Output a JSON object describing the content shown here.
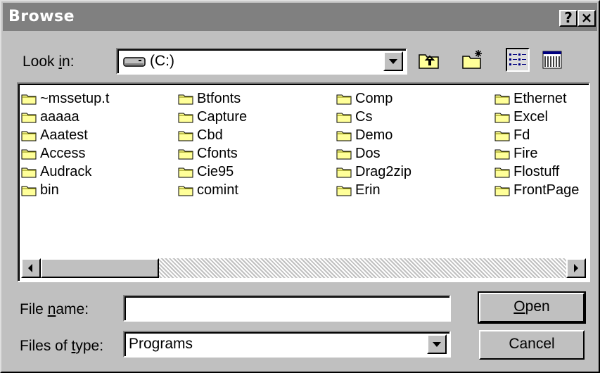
{
  "dialog": {
    "title": "Browse",
    "help_label": "?",
    "close_label": "×"
  },
  "look_in": {
    "label_pre": "Look ",
    "label_accel": "i",
    "label_post": "n:",
    "value": "(C:)"
  },
  "files": [
    "~mssetup.t",
    "aaaaa",
    "Aaatest",
    "Access",
    "Audrack",
    "bin",
    "Btfonts",
    "Capture",
    "Cbd",
    "Cfonts",
    "Cie95",
    "comint",
    "Comp",
    "Cs",
    "Demo",
    "Dos",
    "Drag2zip",
    "Erin",
    "Ethernet",
    "Excel",
    "Fd",
    "Fire",
    "Flostuff",
    "FrontPage"
  ],
  "file_name": {
    "label_pre": "File ",
    "label_accel": "n",
    "label_post": "ame:",
    "value": ""
  },
  "file_type": {
    "label_pre": "Files of ",
    "label_accel": "t",
    "label_post": "ype:",
    "value": "Programs"
  },
  "buttons": {
    "open_accel": "O",
    "open_rest": "pen",
    "cancel": "Cancel"
  },
  "colors": {
    "face": "#c0c0c0",
    "title_bar": "#808080",
    "folder": "#ffff99"
  }
}
